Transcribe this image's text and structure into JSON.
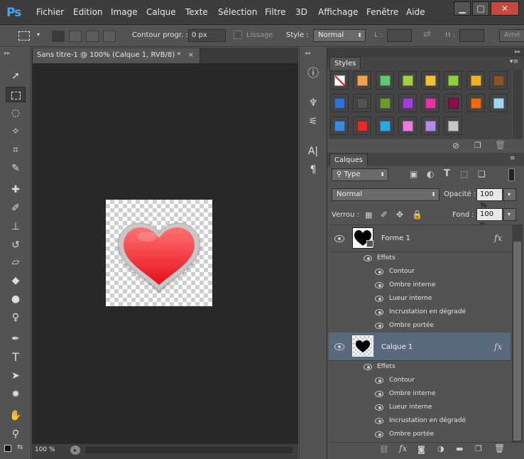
{
  "menubar": {
    "logo": "Ps",
    "items": [
      "Fichier",
      "Edition",
      "Image",
      "Calque",
      "Texte",
      "Sélection",
      "Filtre",
      "3D",
      "Affichage",
      "Fenêtre",
      "Aide"
    ]
  },
  "options": {
    "contour_label": "Contour progr. :",
    "contour_value": "0 px",
    "lissage_label": "Lissage",
    "style_label": "Style :",
    "style_value": "Normal",
    "l_label": "L :",
    "h_label": "H :",
    "ameliorer_label": "Amé"
  },
  "document": {
    "tab_title": "Sans titre-1 @ 100% (Calque 1, RVB/8) *",
    "zoom": "100 %"
  },
  "styles_panel": {
    "tab": "Styles",
    "swatches": [
      {
        "color": "#ffffff",
        "none": true
      },
      {
        "color": "#f5a04a"
      },
      {
        "color": "#5dc96e"
      },
      {
        "color": "#a2cf44"
      },
      {
        "color": "#f2c12e"
      },
      {
        "color": "#8fcf3a"
      },
      {
        "color": "#f2b21c"
      },
      {
        "color": "#8a5526"
      },
      {
        "color": "#2f74d0"
      },
      {
        "color": "#555555"
      },
      {
        "color": "#6d9a2e"
      },
      {
        "color": "#a23ee0"
      },
      {
        "color": "#e832a8"
      },
      {
        "color": "#8a0f4a"
      },
      {
        "color": "#f06a0a"
      },
      {
        "color": "#9fd4f5"
      },
      {
        "color": "#3a8be0"
      },
      {
        "color": "#e52a2a"
      },
      {
        "color": "#2aa8e5"
      },
      {
        "color": "#e87ce0"
      },
      {
        "color": "#b48ce8"
      },
      {
        "color": "#c8c8c8"
      }
    ]
  },
  "layers_panel": {
    "tab": "Calques",
    "filter_label": "Type",
    "blend_mode": "Normal",
    "opacity_label": "Opacité :",
    "opacity_value": "100 %",
    "lock_label": "Verrou :",
    "fill_label": "Fond :",
    "fill_value": "100 %",
    "layers": [
      {
        "name": "Forme 1",
        "effects_label": "Effets",
        "effects": [
          "Contour",
          "Ombre interne",
          "Lueur interne",
          "Incrustation en dégradé",
          "Ombre portée"
        ]
      },
      {
        "name": "Calque 1",
        "effects_label": "Effets",
        "effects": [
          "Contour",
          "Ombre interne",
          "Lueur interne",
          "Incrustation en dégradé",
          "Ombre portée"
        ]
      }
    ]
  },
  "colors": {
    "accent": "#3fa8f4",
    "selected_layer": "#5a6a7e",
    "heart_top": "#ff6b6b",
    "heart_bottom": "#e8121c"
  }
}
